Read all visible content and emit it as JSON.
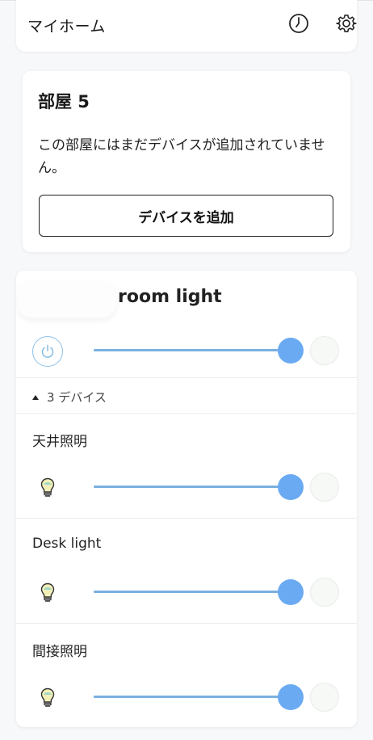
{
  "header": {
    "title": "マイホーム",
    "icons": [
      "clock-icon",
      "gear-icon"
    ]
  },
  "room": {
    "title": "部屋 5",
    "message": "この部屋にはまだデバイスが追加されていません。",
    "add_button_label": "デバイスを追加"
  },
  "group": {
    "title": "room light",
    "brightness": 1.0,
    "device_count_label": "3 デバイス",
    "devices": [
      {
        "name": "天井照明",
        "brightness": 1.0
      },
      {
        "name": "Desk light",
        "brightness": 1.0
      },
      {
        "name": "間接照明",
        "brightness": 1.0
      }
    ]
  },
  "colors": {
    "slider_thumb": "#6aaaf2",
    "slider_track": "#8fb8cc",
    "power_ring": "#8cc0e6"
  }
}
